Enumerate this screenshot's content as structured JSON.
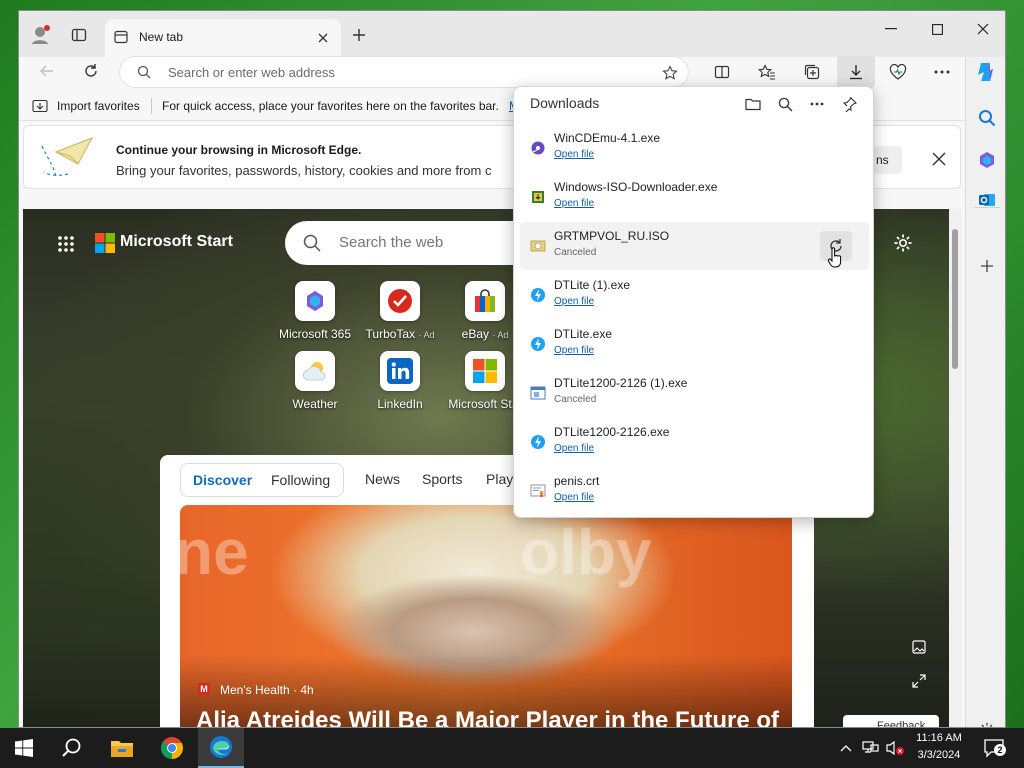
{
  "tab": {
    "title": "New tab"
  },
  "address": {
    "placeholder": "Search or enter web address"
  },
  "favorites_bar": {
    "import_label": "Import favorites",
    "hint": "For quick access, place your favorites here on the favorites bar.",
    "manage_link": "M"
  },
  "banner": {
    "title": "Continue your browsing in Microsoft Edge.",
    "body": "Bring your favorites, passwords, history, cookies and more from c",
    "button_tail": "ns"
  },
  "newtab": {
    "brand": "Microsoft Start",
    "search_placeholder": "Search the web",
    "shortcuts": [
      {
        "label": "Microsoft 365",
        "ad": ""
      },
      {
        "label": "TurboTax",
        "ad": "· Ad"
      },
      {
        "label": "eBay",
        "ad": "· Ad"
      },
      {
        "label": "Weather",
        "ad": ""
      },
      {
        "label": "LinkedIn",
        "ad": ""
      },
      {
        "label": "Microsoft St...",
        "ad": ""
      }
    ],
    "feed_tabs": [
      "Discover",
      "Following",
      "News",
      "Sports",
      "Play"
    ],
    "article": {
      "source": "Men's Health · 4h",
      "headline": "Alia Atreides Will Be a Major Player in the Future of",
      "image_text": "olby"
    },
    "feedback_label": "Feedback"
  },
  "downloads": {
    "title": "Downloads",
    "items": [
      {
        "name": "WinCDEmu-4.1.exe",
        "status": "Open file",
        "link": true
      },
      {
        "name": "Windows-ISO-Downloader.exe",
        "status": "Open file",
        "link": true
      },
      {
        "name": "GRTMPVOL_RU.ISO",
        "status": "Canceled",
        "link": false
      },
      {
        "name": "DTLite (1).exe",
        "status": "Open file",
        "link": true
      },
      {
        "name": "DTLite.exe",
        "status": "Open file",
        "link": true
      },
      {
        "name": "DTLite1200-2126 (1).exe",
        "status": "Canceled",
        "link": false
      },
      {
        "name": "DTLite1200-2126.exe",
        "status": "Open file",
        "link": true
      },
      {
        "name": "penis.crt",
        "status": "Open file",
        "link": true
      }
    ]
  },
  "taskbar": {
    "time": "11:16 AM",
    "date": "3/3/2024",
    "notification_count": "2"
  },
  "colors": {
    "accent": "#0f6cbd",
    "link": "#0f5ea8",
    "edge_blue": "#1479d4"
  }
}
